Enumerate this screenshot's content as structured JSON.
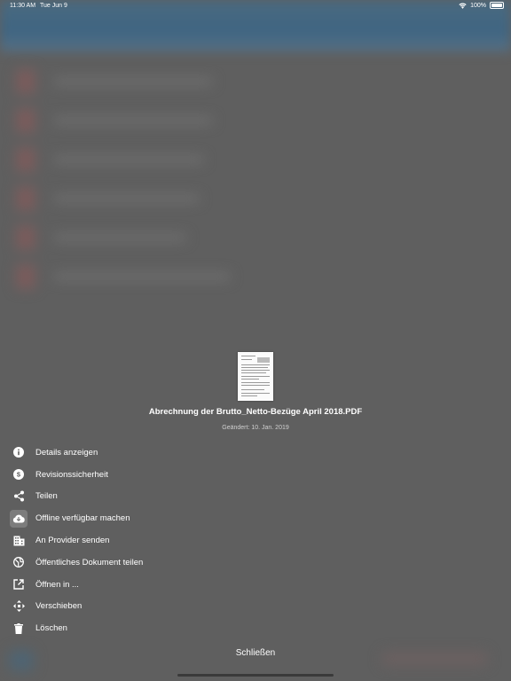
{
  "status_bar": {
    "time": "11:30 AM",
    "date": "Tue Jun 9",
    "battery": "100%"
  },
  "document": {
    "title": "Abrechnung der Brutto_Netto-Bezüge April 2018.PDF",
    "modified": "Geändert: 10. Jan. 2019"
  },
  "menu": {
    "items": [
      {
        "label": "Details anzeigen",
        "icon": "info-icon"
      },
      {
        "label": "Revisionssicherheit",
        "icon": "revision-security-icon"
      },
      {
        "label": "Teilen",
        "icon": "share-icon"
      },
      {
        "label": "Offline verfügbar machen",
        "icon": "cloud-download-icon"
      },
      {
        "label": "An Provider senden",
        "icon": "building-icon"
      },
      {
        "label": "Öffentliches Dokument teilen",
        "icon": "globe-icon"
      },
      {
        "label": "Öffnen in ...",
        "icon": "open-external-icon"
      },
      {
        "label": "Verschieben",
        "icon": "move-icon"
      },
      {
        "label": "Löschen",
        "icon": "trash-icon"
      }
    ]
  },
  "close_label": "Schließen",
  "colors": {
    "overlay": "#5f5f5f",
    "text": "#ffffff",
    "highlight": "#7c7c7c"
  }
}
